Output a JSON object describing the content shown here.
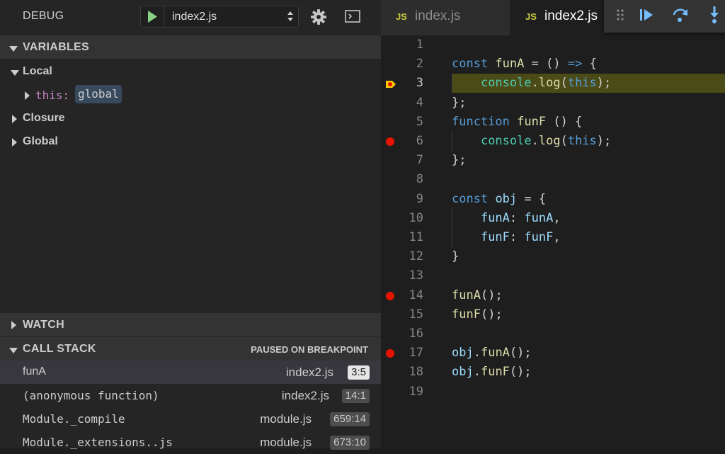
{
  "debug": {
    "title": "DEBUG",
    "config_value": "index2.js"
  },
  "variables": {
    "header": "VARIABLES",
    "scopes": {
      "local": "Local",
      "closure": "Closure",
      "global": "Global"
    },
    "this_key": "this:",
    "this_value": "global"
  },
  "watch": {
    "header": "WATCH"
  },
  "call_stack": {
    "header": "CALL STACK",
    "status": "PAUSED ON BREAKPOINT",
    "frames": [
      {
        "fn": "funA",
        "file": "index2.js",
        "loc": "3:5"
      },
      {
        "fn": "(anonymous function)",
        "file": "index2.js",
        "loc": "14:1"
      },
      {
        "fn": "Module._compile",
        "file": "module.js",
        "loc": "659:14"
      },
      {
        "fn": "Module._extensions..js",
        "file": "module.js",
        "loc": "673:10"
      }
    ]
  },
  "editor": {
    "tabs": [
      {
        "badge": "JS",
        "label": "index.js",
        "active": false
      },
      {
        "badge": "JS",
        "label": "index2.js",
        "active": true
      }
    ],
    "current_line": 3,
    "breakpoints": [
      6,
      14,
      17
    ],
    "line_numbers": [
      "1",
      "2",
      "3",
      "4",
      "5",
      "6",
      "7",
      "8",
      "9",
      "10",
      "11",
      "12",
      "13",
      "14",
      "15",
      "16",
      "17",
      "18",
      "19"
    ],
    "lines": [
      "",
      "const funA = () => {",
      "    console.log(this);",
      "};",
      "function funF () {",
      "    console.log(this);",
      "};",
      "",
      "const obj = {",
      "    funA: funA,",
      "    funF: funF,",
      "}",
      "",
      "funA();",
      "funF();",
      "",
      "obj.funA();",
      "obj.funF();",
      ""
    ]
  },
  "icons": {
    "play": "play-icon",
    "gear": "gear-icon",
    "console": "console-icon",
    "drag": "drag-handle-icon",
    "continue": "continue-icon",
    "step_over": "step-over-icon",
    "step_into": "step-into-icon"
  },
  "colors": {
    "play_green": "#89d185",
    "breakpoint_red": "#e51400",
    "current_line_yellow": "#ffcc00",
    "debug_blue": "#75beff",
    "js_badge": "#cbcb41"
  }
}
